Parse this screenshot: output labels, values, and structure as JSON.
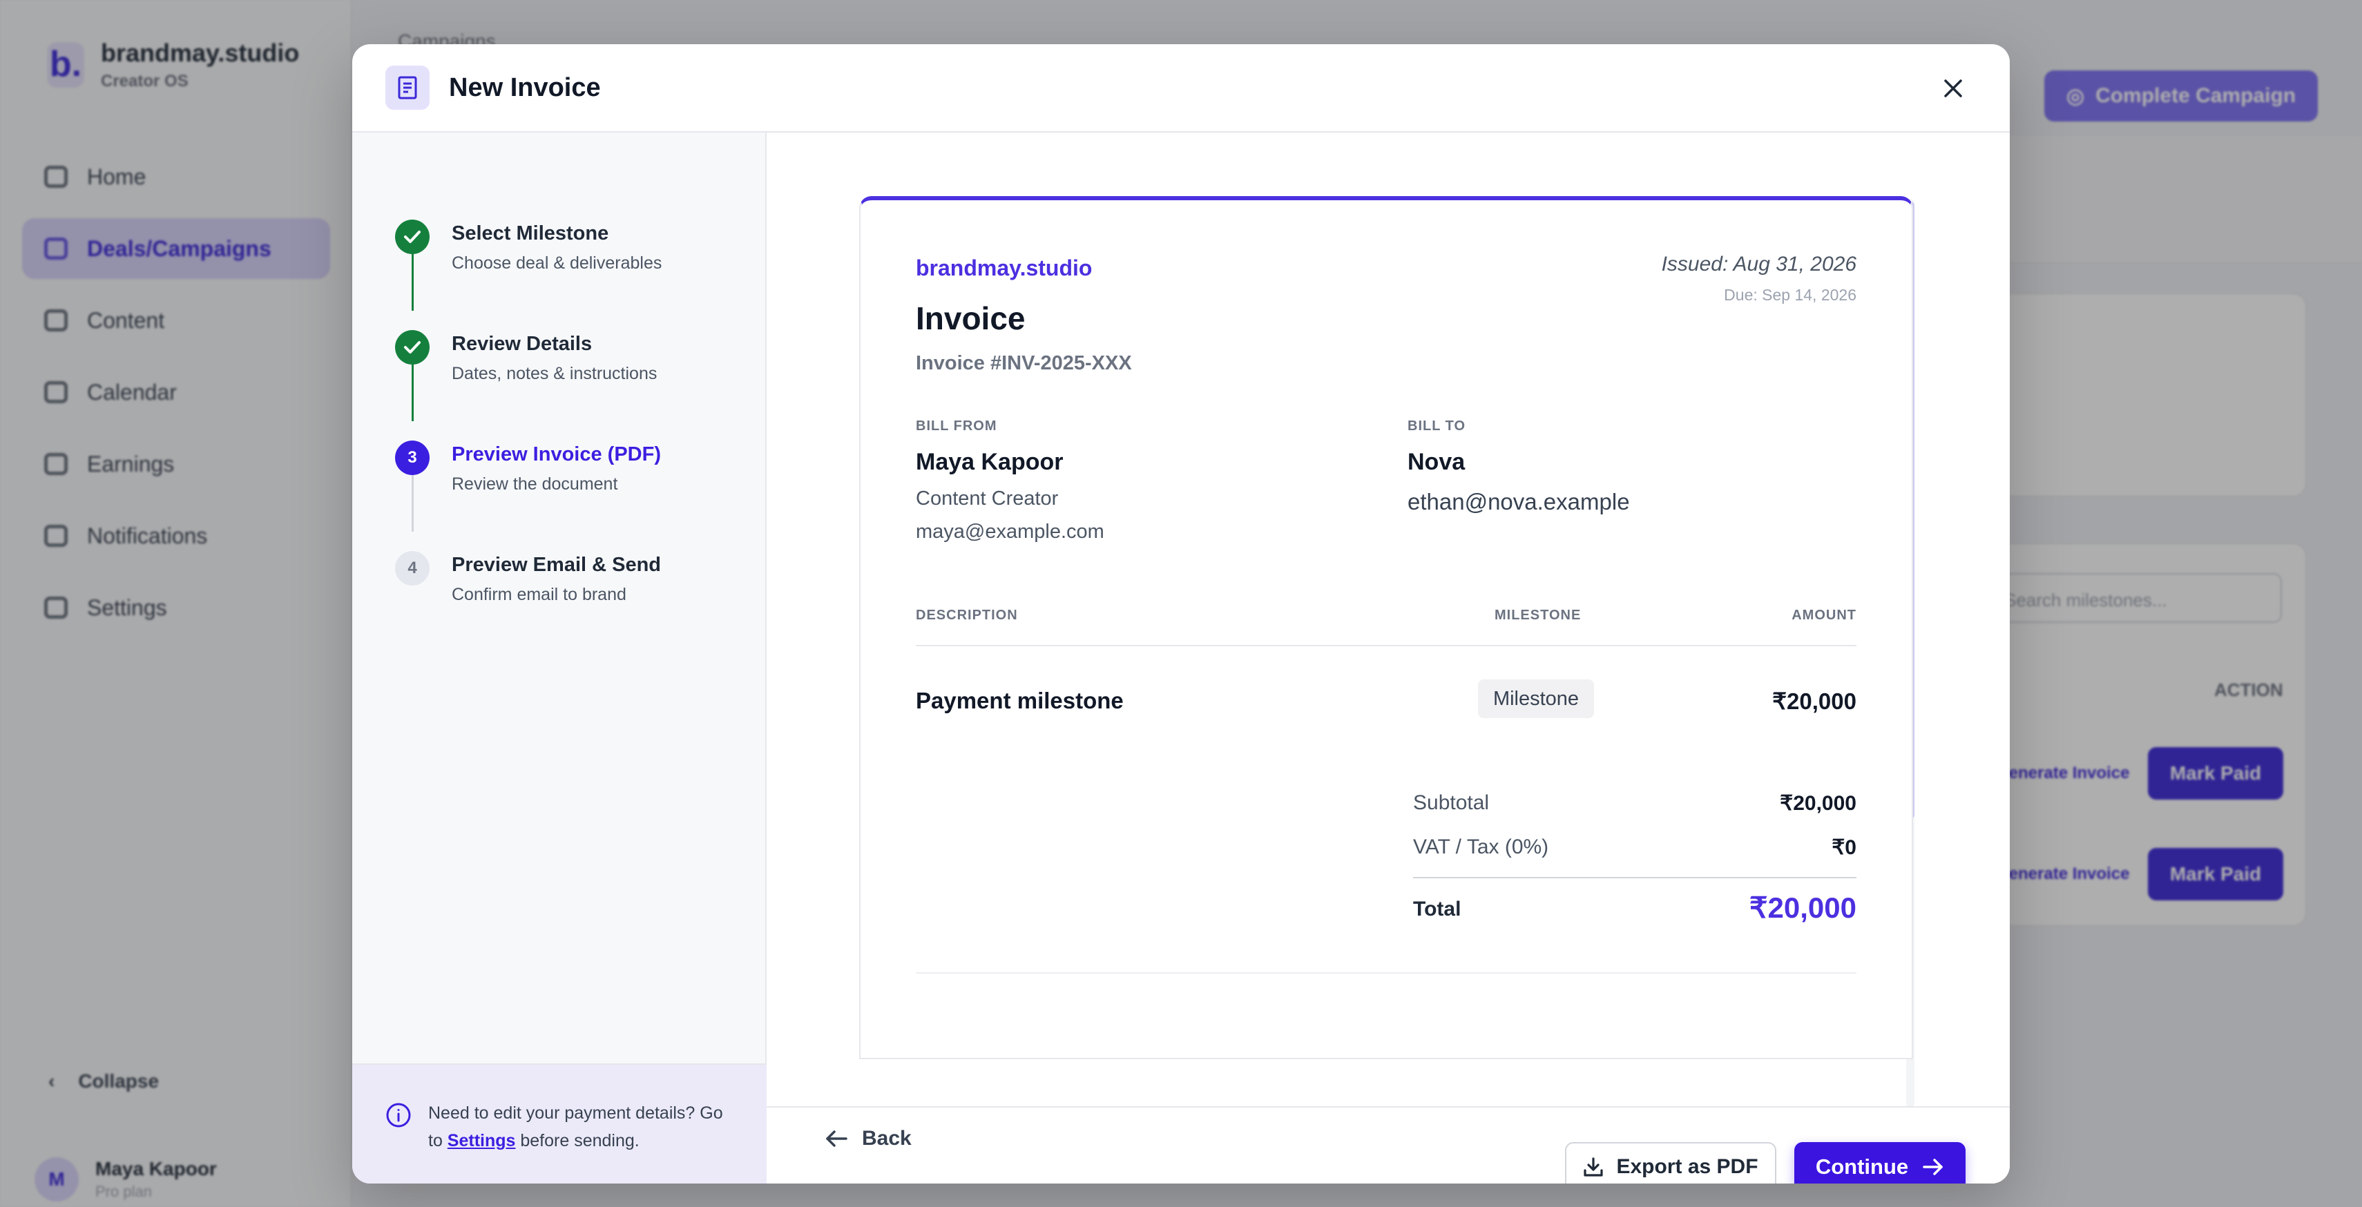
{
  "sidebar": {
    "brand_name": "brandmay.studio",
    "brand_sub": "Creator OS",
    "logo_letter": "b.",
    "items": [
      {
        "label": "Home",
        "icon": "home-icon"
      },
      {
        "label": "Deals/Campaigns",
        "icon": "tag-icon"
      },
      {
        "label": "Content",
        "icon": "content-icon"
      },
      {
        "label": "Calendar",
        "icon": "calendar-icon"
      },
      {
        "label": "Earnings",
        "icon": "money-icon"
      },
      {
        "label": "Notifications",
        "icon": "bell-icon"
      },
      {
        "label": "Settings",
        "icon": "gear-icon"
      }
    ],
    "collapse_label": "Collapse",
    "user_initial": "M",
    "user_name": "Maya Kapoor",
    "user_plan": "Pro plan"
  },
  "background": {
    "breadcrumb": "Campaigns",
    "complete_label": "Complete Campaign",
    "search_placeholder": "Search milestones...",
    "action_header": "ACTION",
    "generate_label": "Generate Invoice",
    "mark_paid_label": "Mark Paid"
  },
  "modal": {
    "title": "New Invoice",
    "steps": [
      {
        "number": "1",
        "title": "Select Milestone",
        "sub": "Choose deal & deliverables",
        "state": "done"
      },
      {
        "number": "2",
        "title": "Review Details",
        "sub": "Dates, notes & instructions",
        "state": "done"
      },
      {
        "number": "3",
        "title": "Preview Invoice (PDF)",
        "sub": "Review the document",
        "state": "active"
      },
      {
        "number": "4",
        "title": "Preview Email & Send",
        "sub": "Confirm email to brand",
        "state": "todo"
      }
    ],
    "help": {
      "text_before": "Need to edit your payment details? Go to ",
      "link": "Settings",
      "text_after": " before sending."
    },
    "footer": {
      "back": "Back",
      "export": "Export as PDF",
      "continue": "Continue"
    }
  },
  "invoice": {
    "brand": "brandmay.studio",
    "issued": "Issued: Aug 31, 2026",
    "due": "Due: Sep 14, 2026",
    "title": "Invoice",
    "number": "Invoice #INV-2025-XXX",
    "bill_from_label": "BILL FROM",
    "from_name": "Maya Kapoor",
    "from_role": "Content Creator",
    "from_email": "maya@example.com",
    "bill_to_label": "BILL TO",
    "to_name": "Nova",
    "to_email": "ethan@nova.example",
    "columns": {
      "description": "DESCRIPTION",
      "milestone": "MILESTONE",
      "amount": "AMOUNT"
    },
    "line": {
      "description": "Payment milestone",
      "milestone": "Milestone",
      "amount": "₹20,000"
    },
    "subtotal_label": "Subtotal",
    "subtotal": "₹20,000",
    "tax_label": "VAT / Tax (0%)",
    "tax": "₹0",
    "total_label": "Total",
    "total": "₹20,000"
  },
  "colors": {
    "accent": "#3b14e0",
    "success": "#15803d"
  }
}
